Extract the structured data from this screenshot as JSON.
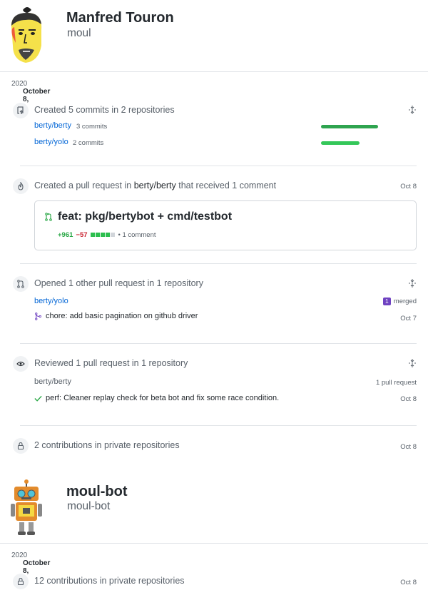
{
  "users": [
    {
      "name": "Manfred Touron",
      "login": "moul",
      "date": "October 8,",
      "year": "2020"
    },
    {
      "name": "moul-bot",
      "login": "moul-bot",
      "date": "October 8,",
      "year": "2020"
    }
  ],
  "commits": {
    "title": "Created 5 commits in 2 repositories",
    "repos": [
      {
        "name": "berty/berty",
        "count": "3 commits",
        "fraction": 0.6
      },
      {
        "name": "berty/yolo",
        "count": "2 commits",
        "fraction": 0.4
      }
    ]
  },
  "pr_created": {
    "title_pre": "Created a pull request in",
    "repo": "berty/berty",
    "title_post": "that received 1 comment",
    "date": "Oct 8",
    "pr_title": "feat: pkg/bertybot + cmd/testbot",
    "additions": "+961",
    "deletions": "−57",
    "comments": "• 1 comment"
  },
  "pr_opened": {
    "title": "Opened 1 other pull request in 1 repository",
    "repo": "berty/yolo",
    "merged_count": "1",
    "merged_label": "merged",
    "pr_title": "chore: add basic pagination on github driver",
    "date": "Oct 7"
  },
  "reviewed": {
    "title": "Reviewed 1 pull request in 1 repository",
    "repo": "berty/berty",
    "count_label": "1 pull request",
    "pr_title": "perf: Cleaner replay check for beta bot and fix some race condition.",
    "date": "Oct 8"
  },
  "private1": {
    "title": "2 contributions in private repositories",
    "date": "Oct 8"
  },
  "private2": {
    "title": "12 contributions in private repositories",
    "date": "Oct 8"
  },
  "colors": {
    "link": "#0366d6",
    "green": "#2ea44f",
    "purple": "#6f42c1",
    "red": "#cb2431"
  }
}
